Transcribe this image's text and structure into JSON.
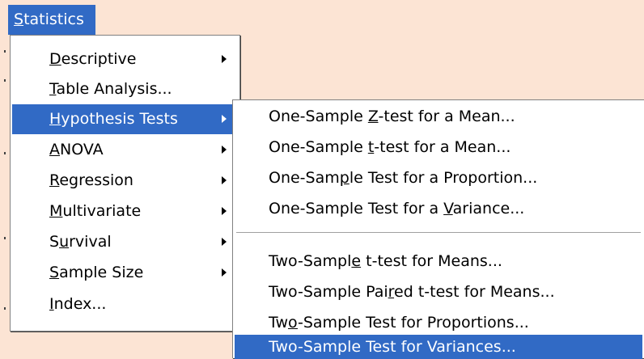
{
  "menubar": {
    "statistics": {
      "pre": "",
      "key": "S",
      "post": "tatistics"
    }
  },
  "main_menu": {
    "items": [
      {
        "pre": "",
        "key": "D",
        "post": "escriptive",
        "submenu": true
      },
      {
        "pre": "",
        "key": "T",
        "post": "able Analysis...",
        "submenu": false
      },
      {
        "pre": "",
        "key": "H",
        "post": "ypothesis Tests",
        "submenu": true,
        "active": true
      },
      {
        "pre": "",
        "key": "A",
        "post": "NOVA",
        "submenu": true
      },
      {
        "pre": "",
        "key": "R",
        "post": "egression",
        "submenu": true
      },
      {
        "pre": "",
        "key": "M",
        "post": "ultivariate",
        "submenu": true
      },
      {
        "pre": "S",
        "key": "u",
        "post": "rvival",
        "submenu": true
      },
      {
        "pre": "",
        "key": "S",
        "post": "ample Size",
        "submenu": true
      },
      {
        "pre": "",
        "key": "I",
        "post": "ndex...",
        "submenu": false
      }
    ]
  },
  "sub_menu": {
    "group1": [
      {
        "pre": "One-Sample ",
        "key": "Z",
        "post": "-test for a Mean..."
      },
      {
        "pre": "One-Sample ",
        "key": "t",
        "post": "-test for a Mean..."
      },
      {
        "pre": "One-Sam",
        "key": "p",
        "post": "le Test for a Proportion..."
      },
      {
        "pre": "One-Sample Test for a ",
        "key": "V",
        "post": "ariance..."
      }
    ],
    "group2": [
      {
        "pre": "Two-Sampl",
        "key": "e",
        "post": " t-test for Means..."
      },
      {
        "pre": "Two-Sample Pai",
        "key": "r",
        "post": "ed t-test for Means..."
      },
      {
        "pre": "Tw",
        "key": "o",
        "post": "-Sample Test for Proportions..."
      },
      {
        "pre": "Two-Sample Test for Variances...",
        "key": "",
        "post": "",
        "active": true
      }
    ]
  },
  "colors": {
    "highlight": "#316ac5",
    "background": "#fce4d4",
    "menu": "#ffffff"
  }
}
